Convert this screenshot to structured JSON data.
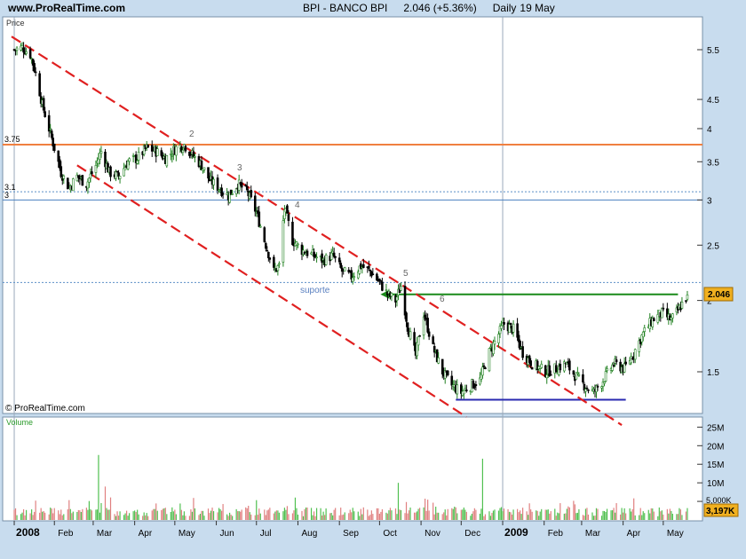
{
  "header": {
    "site": "www.ProRealTime.com",
    "ticker": "BPI - BANCO BPI",
    "quote": "2.046 (+5.36%)",
    "period": "Daily",
    "date": "19 May"
  },
  "watermark": "© ProRealTime.com",
  "price_panel_label": "Price",
  "volume_panel_label": "Volume",
  "price_badge": "2.046",
  "volume_badge": "3,197K",
  "volume_ref_label": "5,000K",
  "annotations": {
    "pivots": [
      "2",
      "3",
      "4",
      "5",
      "6"
    ],
    "support_label": "suporte",
    "left_levels": [
      "3.75",
      "3.1",
      "3"
    ]
  },
  "colors": {
    "panel_bg": "#ffffff",
    "frame_bg": "#c8dcee",
    "channel": "#e02020",
    "resistance": "#f08040",
    "breakout": "#1a8a1a",
    "support_line": "#2a2ab0",
    "up_candle": "#208020",
    "down_candle": "#000000",
    "volume_up": "#50c050",
    "volume_down": "#e08080",
    "badge_bg": "#f0b020"
  },
  "chart_data": [
    {
      "type": "candlestick",
      "scale": "log",
      "y_ticks": [
        1.5,
        2,
        2.5,
        3,
        3.5,
        4,
        4.5,
        5.5
      ],
      "y_tick_labels": [
        "1.5",
        "2",
        "2.5",
        "3",
        "3.5",
        "4",
        "4.5",
        "5.5"
      ],
      "x_ticks": [
        "2008",
        "Feb",
        "Mar",
        "Apr",
        "May",
        "Jun",
        "Jul",
        "Aug",
        "Sep",
        "Oct",
        "Nov",
        "Dec",
        "2009",
        "Feb",
        "Mar",
        "Apr",
        "May"
      ],
      "last_close": 2.046,
      "path": [
        [
          "2008-01-02",
          5.5
        ],
        [
          "2008-01-08",
          5.55
        ],
        [
          "2008-01-14",
          5.4
        ],
        [
          "2008-01-18",
          5.0
        ],
        [
          "2008-01-23",
          4.4
        ],
        [
          "2008-01-28",
          4.0
        ],
        [
          "2008-02-01",
          3.7
        ],
        [
          "2008-02-06",
          3.35
        ],
        [
          "2008-02-12",
          3.15
        ],
        [
          "2008-02-18",
          3.3
        ],
        [
          "2008-02-25",
          3.2
        ],
        [
          "2008-03-03",
          3.45
        ],
        [
          "2008-03-07",
          3.65
        ],
        [
          "2008-03-13",
          3.35
        ],
        [
          "2008-03-20",
          3.3
        ],
        [
          "2008-03-27",
          3.5
        ],
        [
          "2008-04-03",
          3.55
        ],
        [
          "2008-04-10",
          3.7
        ],
        [
          "2008-04-17",
          3.65
        ],
        [
          "2008-04-24",
          3.55
        ],
        [
          "2008-05-02",
          3.7
        ],
        [
          "2008-05-08",
          3.75
        ],
        [
          "2008-05-14",
          3.6
        ],
        [
          "2008-05-21",
          3.45
        ],
        [
          "2008-05-27",
          3.25
        ],
        [
          "2008-06-03",
          3.15
        ],
        [
          "2008-06-10",
          3.05
        ],
        [
          "2008-06-17",
          3.2
        ],
        [
          "2008-06-24",
          3.1
        ],
        [
          "2008-07-01",
          2.85
        ],
        [
          "2008-07-07",
          2.55
        ],
        [
          "2008-07-14",
          2.25
        ],
        [
          "2008-07-18",
          2.3
        ],
        [
          "2008-07-22",
          2.9
        ],
        [
          "2008-07-28",
          2.55
        ],
        [
          "2008-08-04",
          2.45
        ],
        [
          "2008-08-12",
          2.4
        ],
        [
          "2008-08-20",
          2.35
        ],
        [
          "2008-08-27",
          2.4
        ],
        [
          "2008-09-03",
          2.25
        ],
        [
          "2008-09-10",
          2.2
        ],
        [
          "2008-09-17",
          2.3
        ],
        [
          "2008-09-24",
          2.25
        ],
        [
          "2008-10-01",
          2.15
        ],
        [
          "2008-10-07",
          2.05
        ],
        [
          "2008-10-13",
          2.0
        ],
        [
          "2008-10-17",
          2.12
        ],
        [
          "2008-10-22",
          1.8
        ],
        [
          "2008-10-28",
          1.6
        ],
        [
          "2008-11-03",
          1.9
        ],
        [
          "2008-11-10",
          1.65
        ],
        [
          "2008-11-17",
          1.5
        ],
        [
          "2008-11-24",
          1.42
        ],
        [
          "2008-12-01",
          1.38
        ],
        [
          "2008-12-08",
          1.42
        ],
        [
          "2008-12-15",
          1.45
        ],
        [
          "2008-12-22",
          1.62
        ],
        [
          "2009-01-02",
          1.82
        ],
        [
          "2009-01-09",
          1.78
        ],
        [
          "2009-01-16",
          1.62
        ],
        [
          "2009-01-23",
          1.55
        ],
        [
          "2009-02-02",
          1.5
        ],
        [
          "2009-02-10",
          1.52
        ],
        [
          "2009-02-17",
          1.55
        ],
        [
          "2009-02-24",
          1.48
        ],
        [
          "2009-03-03",
          1.42
        ],
        [
          "2009-03-10",
          1.38
        ],
        [
          "2009-03-17",
          1.45
        ],
        [
          "2009-03-25",
          1.55
        ],
        [
          "2009-04-02",
          1.52
        ],
        [
          "2009-04-09",
          1.62
        ],
        [
          "2009-04-16",
          1.75
        ],
        [
          "2009-04-23",
          1.85
        ],
        [
          "2009-04-30",
          1.9
        ],
        [
          "2009-05-07",
          1.85
        ],
        [
          "2009-05-12",
          1.92
        ],
        [
          "2009-05-19",
          2.046
        ]
      ],
      "lines": [
        {
          "name": "resistance",
          "y": 3.75
        },
        {
          "name": "level-3.1",
          "y": 3.1,
          "dashed": true
        },
        {
          "name": "level-3",
          "y": 3.0
        },
        {
          "name": "level-2.15",
          "y": 2.15,
          "dashed": true
        },
        {
          "name": "breakout",
          "y": 2.05,
          "x0": "2008-10-03",
          "x1": "2009-05-12"
        },
        {
          "name": "support",
          "y": 1.34,
          "x0": "2008-11-27",
          "x1": "2009-04-03"
        }
      ],
      "channel": [
        {
          "x0": "2007-12-31",
          "y0": 5.8,
          "x1": "2009-03-31",
          "y1": 1.21
        },
        {
          "x0": "2008-02-18",
          "y0": 3.45,
          "x1": "2008-12-05",
          "y1": 1.25
        }
      ],
      "pivot_points": [
        {
          "label": "2",
          "date": "2008-05-08",
          "y": 3.95
        },
        {
          "label": "3",
          "date": "2008-06-12",
          "y": 3.42
        },
        {
          "label": "4",
          "date": "2008-07-25",
          "y": 2.95
        },
        {
          "label": "5",
          "date": "2008-10-17",
          "y": 2.22
        },
        {
          "label": "6",
          "date": "2008-11-05",
          "y": 2.0
        }
      ]
    },
    {
      "type": "bar",
      "name": "Volume",
      "y_ticks": [
        5000000,
        10000000,
        15000000,
        20000000,
        25000000
      ],
      "y_tick_labels": [
        "5M",
        "10M",
        "15M",
        "20M",
        "25M"
      ],
      "last_value": 3197000
    }
  ]
}
